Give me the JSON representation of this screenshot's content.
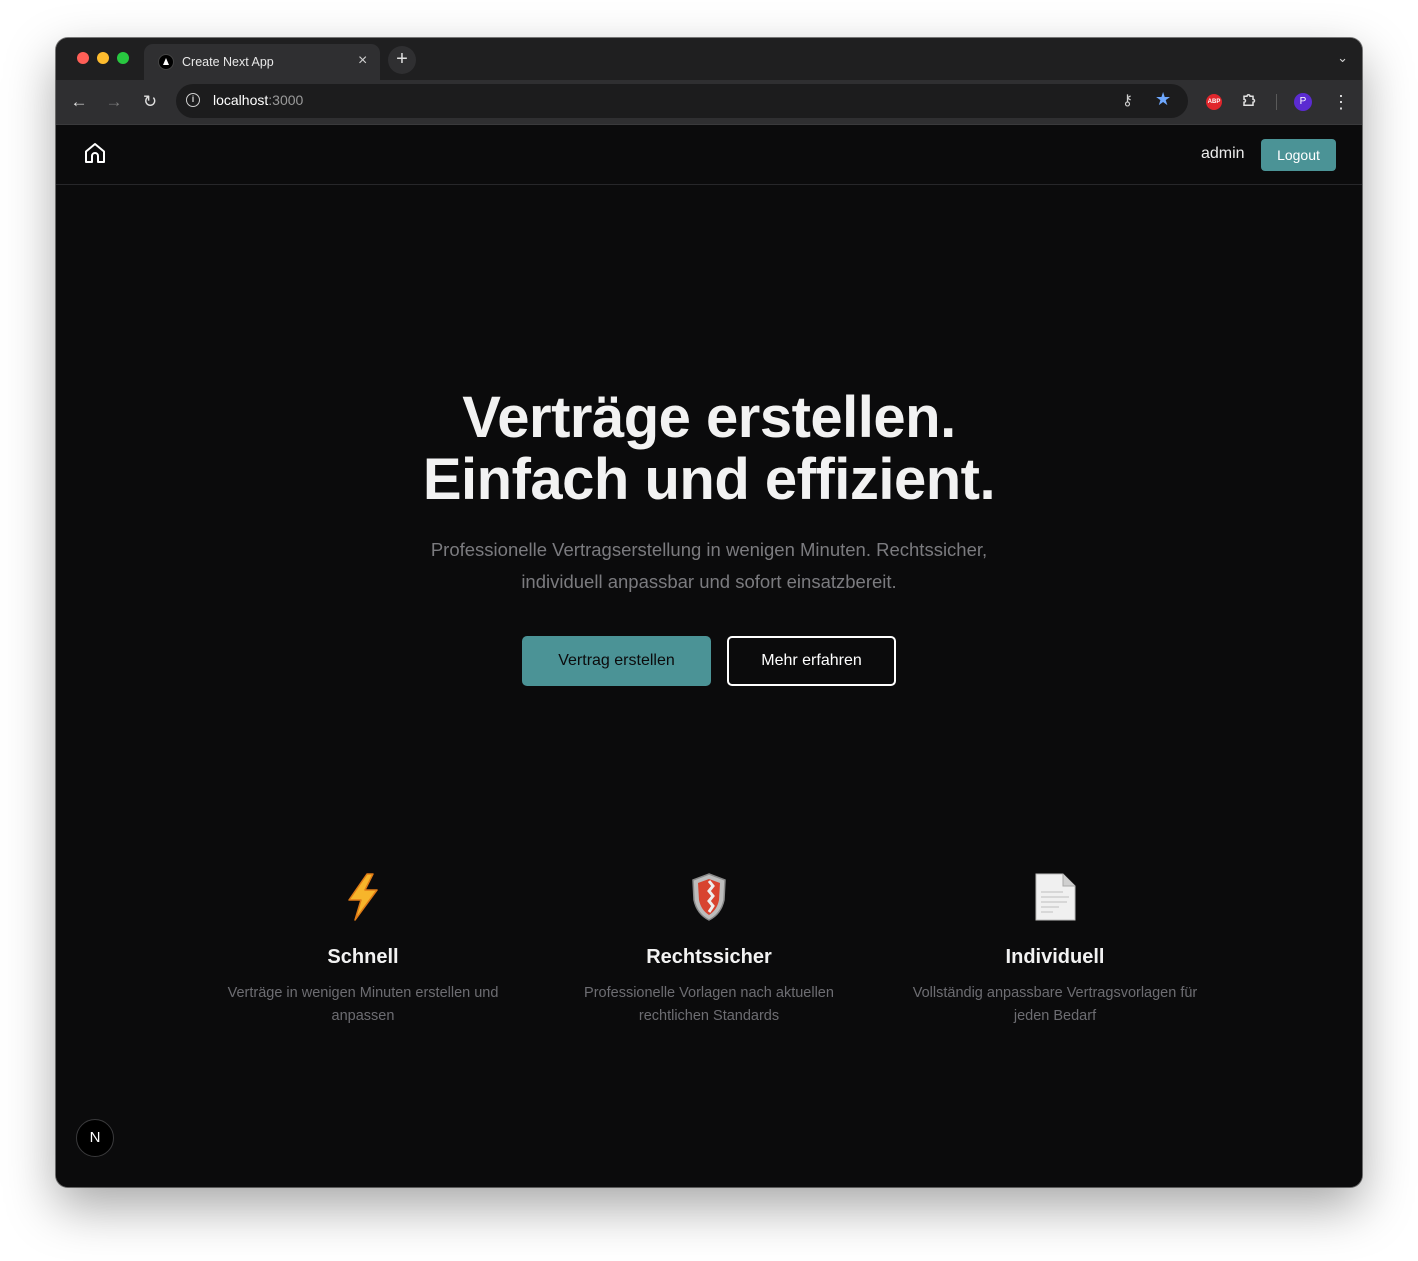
{
  "browser": {
    "tab_title": "Create Next App",
    "tab_close": "×",
    "new_tab": "+",
    "tabs_menu": "⌄",
    "url_host": "localhost",
    "url_port": ":3000",
    "profile_initial": "P",
    "abp_label": "ABP",
    "nav": {
      "back": "←",
      "forward": "→",
      "reload": "↻"
    }
  },
  "navbar": {
    "user_label": "admin",
    "logout_label": "Logout"
  },
  "hero": {
    "title_line1": "Verträge erstellen.",
    "title_line2": "Einfach und effizient.",
    "subtitle_line1": "Professionelle Vertragserstellung in wenigen Minuten. Rechtssicher,",
    "subtitle_line2": "individuell anpassbar und sofort einsatzbereit.",
    "primary_cta": "Vertrag erstellen",
    "secondary_cta": "Mehr erfahren"
  },
  "features": [
    {
      "icon": "lightning-icon",
      "title": "Schnell",
      "desc_line1": "Verträge in wenigen Minuten erstellen und",
      "desc_line2": "anpassen"
    },
    {
      "icon": "shield-icon",
      "title": "Rechtssicher",
      "desc_line1": "Professionelle Vorlagen nach aktuellen",
      "desc_line2": "rechtlichen Standards"
    },
    {
      "icon": "document-icon",
      "title": "Individuell",
      "desc_line1": "Vollständig anpassbare Vertragsvorlagen für",
      "desc_line2": "jeden Bedarf"
    }
  ],
  "dev_badge": "N",
  "colors": {
    "accent": "#4b9396",
    "page_bg": "#0b0b0c",
    "muted_text": "#7b7b7f"
  }
}
